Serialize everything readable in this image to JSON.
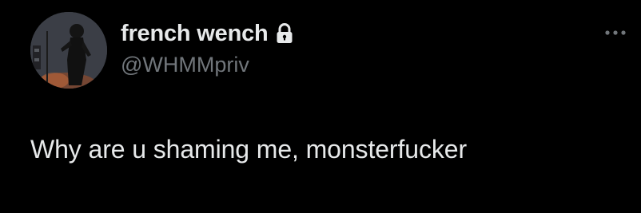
{
  "tweet": {
    "author": {
      "display_name": "french wench",
      "handle": "@WHMMpriv",
      "verified_icon": "lock-icon",
      "avatar_icon": "avatar-photo"
    },
    "text": "Why are u shaming me, monsterfucker",
    "more_icon": "more-options-icon"
  },
  "colors": {
    "background": "#000000",
    "primary_text": "#e7e9ea",
    "secondary_text": "#71767b"
  }
}
